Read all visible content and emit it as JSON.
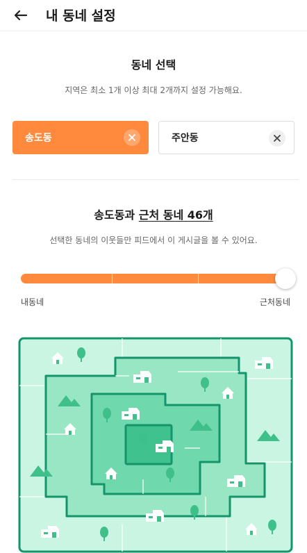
{
  "header": {
    "title": "내 동네 설정",
    "back_icon": "arrow-left-icon"
  },
  "select": {
    "title": "동네 선택",
    "subtitle": "지역은 최소 1개 이상 최대 2개까지 설정 가능해요.",
    "chips": [
      {
        "label": "송도동",
        "selected": true
      },
      {
        "label": "주안동",
        "selected": false
      }
    ]
  },
  "range": {
    "title_prefix": "송도동과 ",
    "title_underlined": "근처 동네 46개",
    "subtitle": "선택한 동네의 이웃들만 피드에서 이 게시글을 볼 수 있어요.",
    "min_label": "내동네",
    "max_label": "근처동네",
    "level": 1.0,
    "steps": 4
  },
  "colors": {
    "accent": "#ff8a3d",
    "map_outer": "#c9f5e2",
    "map_ring2": "#98e6c4",
    "map_ring3": "#6fd8ac",
    "map_core": "#3fc28e",
    "map_border": "#14946a"
  }
}
